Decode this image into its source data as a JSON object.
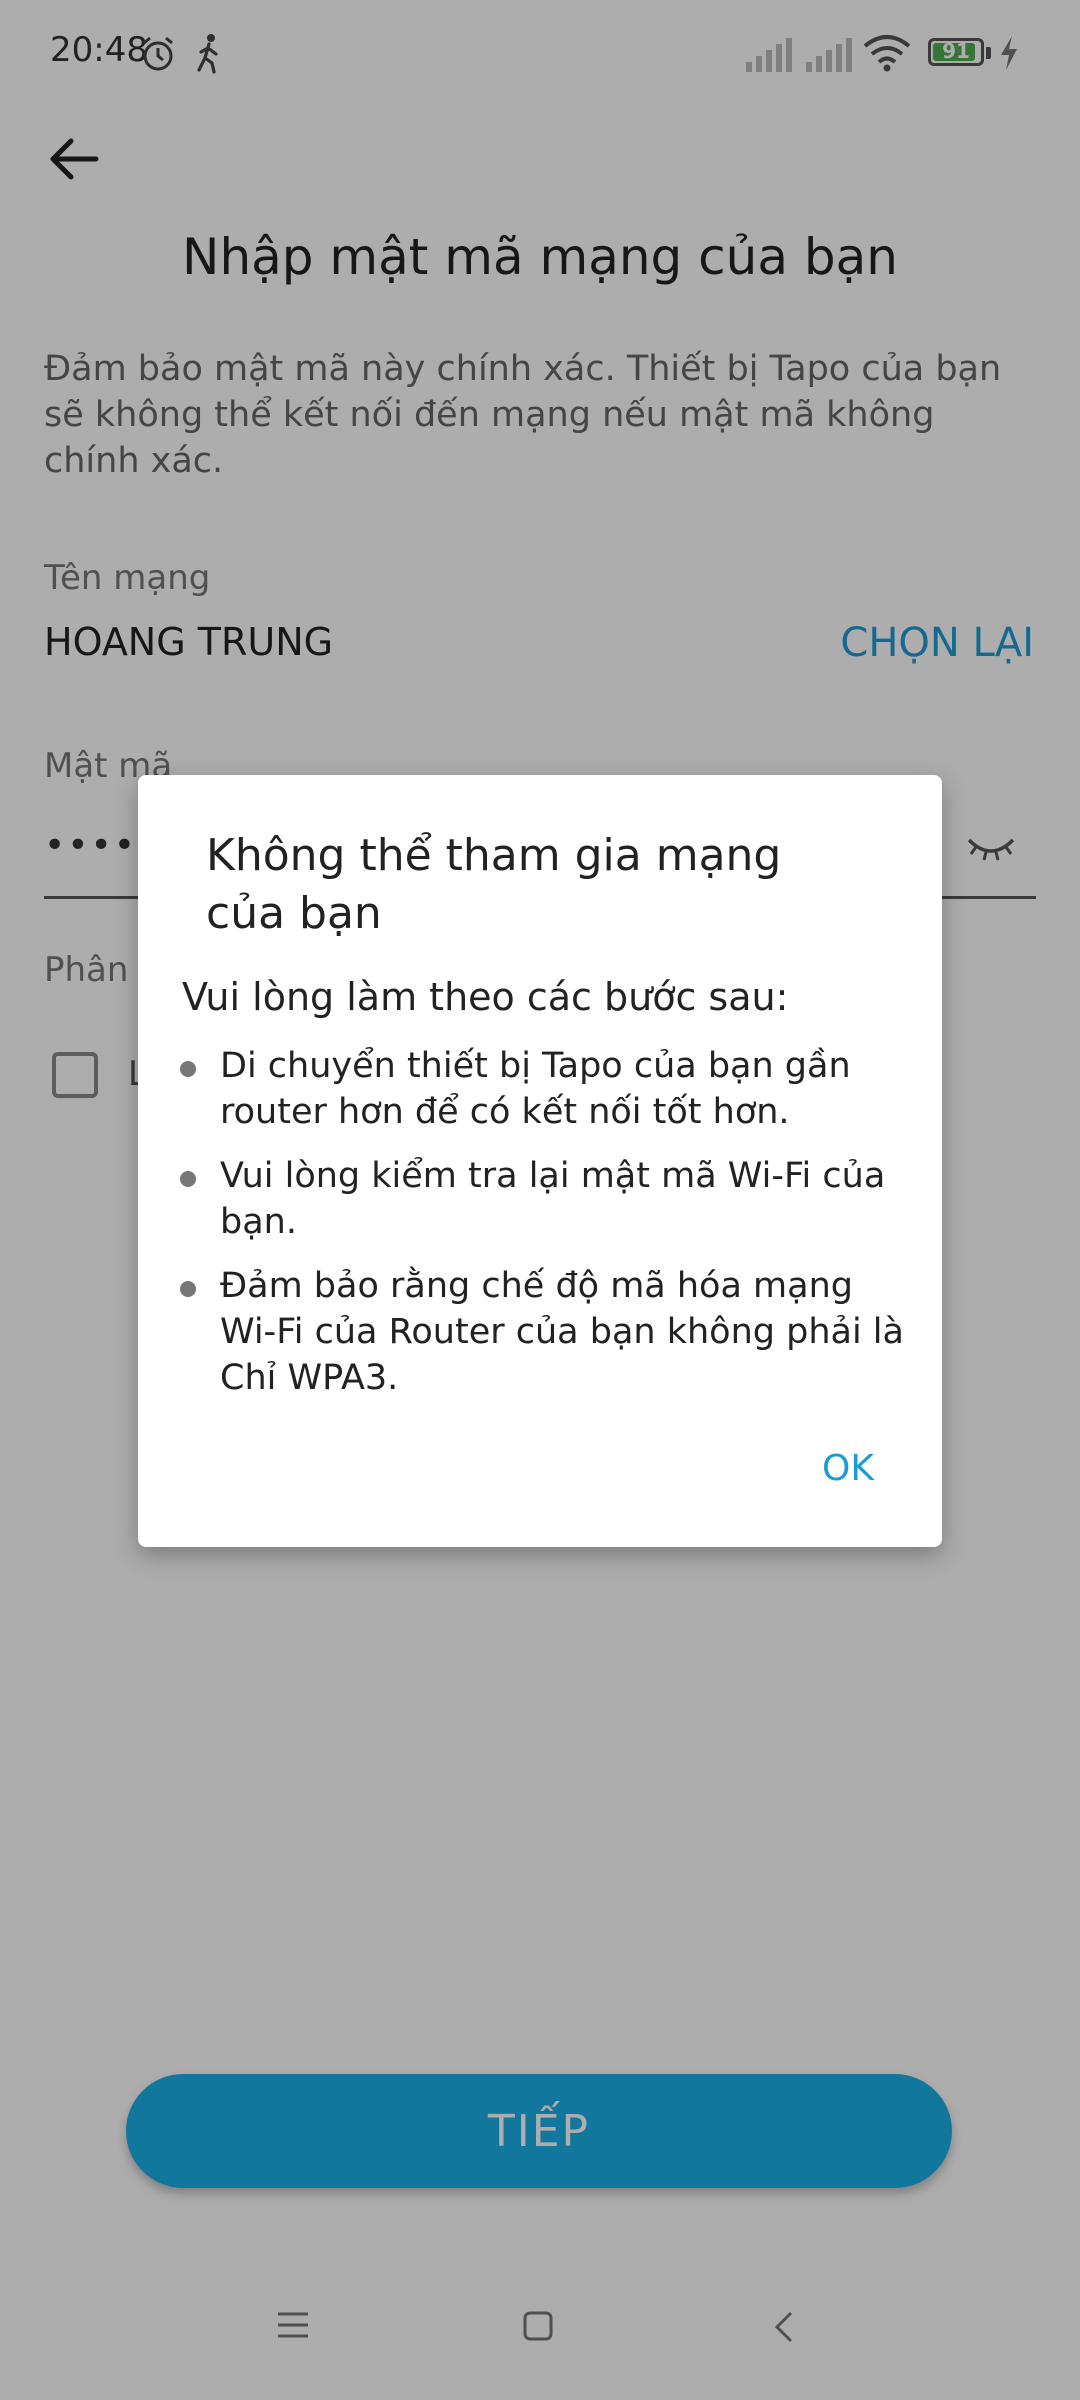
{
  "status_bar": {
    "time": "20:48",
    "battery": "91",
    "battery_level": 0.91,
    "icons": [
      "alarm-icon",
      "walk-icon",
      "signal-icon",
      "signal-icon",
      "wifi-icon",
      "battery-icon",
      "charging-icon"
    ]
  },
  "header": {
    "back_icon": "arrow-left-icon",
    "title": "Nhập mật mã mạng của bạn"
  },
  "description": "Đảm bảo mật mã này chính xác. Thiết bị Tapo của bạn sẽ không thể kết nối đến mạng nếu mật mã không chính xác.",
  "network": {
    "label": "Tên mạng",
    "name": "HOANG TRUNG",
    "rechoose_label": "CHỌN LẠI"
  },
  "password": {
    "label": "Mật mã",
    "value": "•••••••",
    "visibility_icon": "eye-closed-icon"
  },
  "section": {
    "label": "Phân",
    "checkbox_label": "L"
  },
  "next_button_label": "TIẾP",
  "dialog": {
    "title": "Không thể tham gia mạng của bạn",
    "subtitle": "Vui lòng làm theo các bước sau:",
    "steps": [
      "Di chuyển thiết bị Tapo của bạn gần router hơn để có kết nối tốt hơn.",
      "Vui lòng kiểm tra lại mật mã Wi-Fi của bạn.",
      "Đảm bảo rằng chế độ mã hóa mạng Wi-Fi của Router của bạn không phải là Chỉ WPA3."
    ],
    "ok_label": "OK"
  },
  "nav_bar": {
    "icons": [
      "menu-icon",
      "home-icon",
      "back-icon"
    ]
  },
  "colors": {
    "accent": "#1d9bd6",
    "button": "#1bb0e8",
    "scrim": "rgba(0,0,0,0.32)"
  }
}
